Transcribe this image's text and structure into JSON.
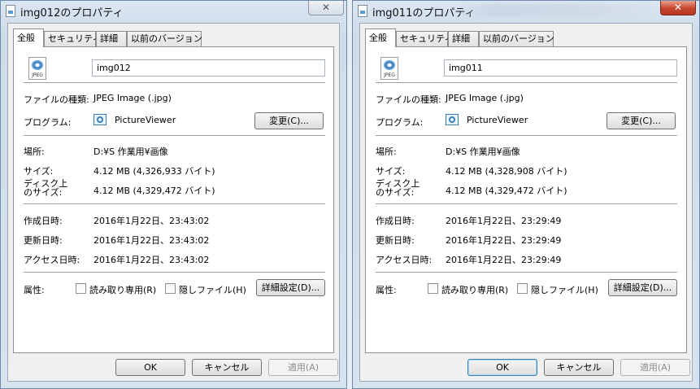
{
  "left": {
    "title": "img012のプロパティ",
    "close_label": "✕",
    "tabs": [
      "全般",
      "セキュリティ",
      "詳細",
      "以前のバージョン"
    ],
    "file_icon_text": "JPEG",
    "file_name": "img012",
    "rows": {
      "type_label": "ファイルの種類:",
      "type_value": "JPEG Image (.jpg)",
      "program_label": "プログラム:",
      "program_value": "PictureViewer",
      "change_button": "変更(C)...",
      "location_label": "場所:",
      "location_value": "D:¥S 作業用¥画像",
      "size_label": "サイズ:",
      "size_value": "4.12 MB (4,326,933 バイト)",
      "disk_label_1": "ディスク上",
      "disk_label_2": "のサイズ:",
      "disk_value": "4.12 MB (4,329,472 バイト)",
      "created_label": "作成日時:",
      "created_value": "2016年1月22日、23:43:02",
      "modified_label": "更新日時:",
      "modified_value": "2016年1月22日、23:43:02",
      "accessed_label": "アクセス日時:",
      "accessed_value": "2016年1月22日、23:43:02",
      "attr_label": "属性:",
      "readonly_label": "読み取り専用(R)",
      "hidden_label": "隠しファイル(H)",
      "advanced_button": "詳細設定(D)..."
    },
    "buttons": {
      "ok": "OK",
      "cancel": "キャンセル",
      "apply": "適用(A)"
    }
  },
  "right": {
    "title": "img011のプロパティ",
    "close_label": "✕",
    "tabs": [
      "全般",
      "セキュリティ",
      "詳細",
      "以前のバージョン"
    ],
    "file_icon_text": "JPEG",
    "file_name": "img011",
    "rows": {
      "type_label": "ファイルの種類:",
      "type_value": "JPEG Image (.jpg)",
      "program_label": "プログラム:",
      "program_value": "PictureViewer",
      "change_button": "変更(C)...",
      "location_label": "場所:",
      "location_value": "D:¥S 作業用¥画像",
      "size_label": "サイズ:",
      "size_value": "4.12 MB (4,328,908 バイト)",
      "disk_label_1": "ディスク上",
      "disk_label_2": "のサイズ:",
      "disk_value": "4.12 MB (4,329,472 バイト)",
      "created_label": "作成日時:",
      "created_value": "2016年1月22日、23:29:49",
      "modified_label": "更新日時:",
      "modified_value": "2016年1月22日、23:29:49",
      "accessed_label": "アクセス日時:",
      "accessed_value": "2016年1月22日、23:29:49",
      "attr_label": "属性:",
      "readonly_label": "読み取り専用(R)",
      "hidden_label": "隠しファイル(H)",
      "advanced_button": "詳細設定(D)..."
    },
    "buttons": {
      "ok": "OK",
      "cancel": "キャンセル",
      "apply": "適用(A)"
    }
  }
}
